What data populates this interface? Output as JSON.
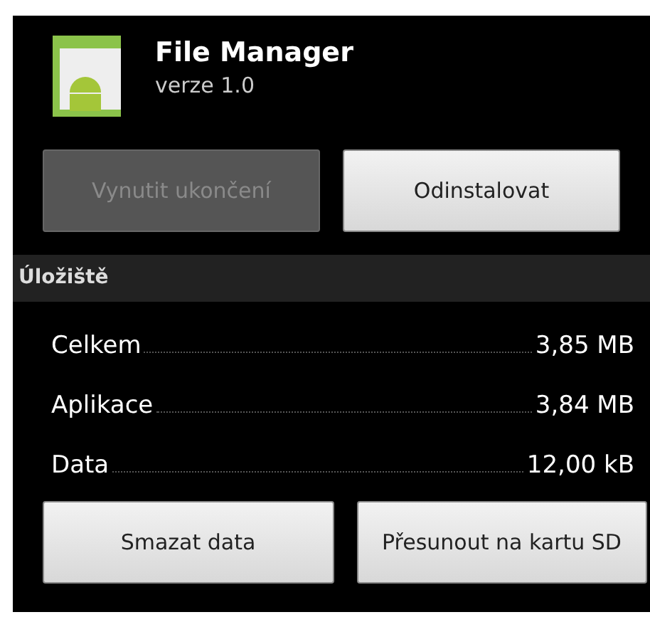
{
  "app": {
    "name": "File Manager",
    "version": "verze 1.0"
  },
  "actions": [
    {
      "label": "Vynutit ukončení",
      "disabled": true
    },
    {
      "label": "Odinstalovat",
      "disabled": false
    }
  ],
  "section": {
    "title": "Úložiště"
  },
  "storage_rows": [
    {
      "label": "Celkem",
      "value": "3,85 MB"
    },
    {
      "label": "Aplikace",
      "value": "3,84 MB"
    },
    {
      "label": "Data",
      "value": "12,00 kB"
    }
  ],
  "storage_actions": [
    {
      "label": "Smazat data",
      "disabled": false
    },
    {
      "label": "Přesunout na kartu SD",
      "disabled": false
    }
  ]
}
